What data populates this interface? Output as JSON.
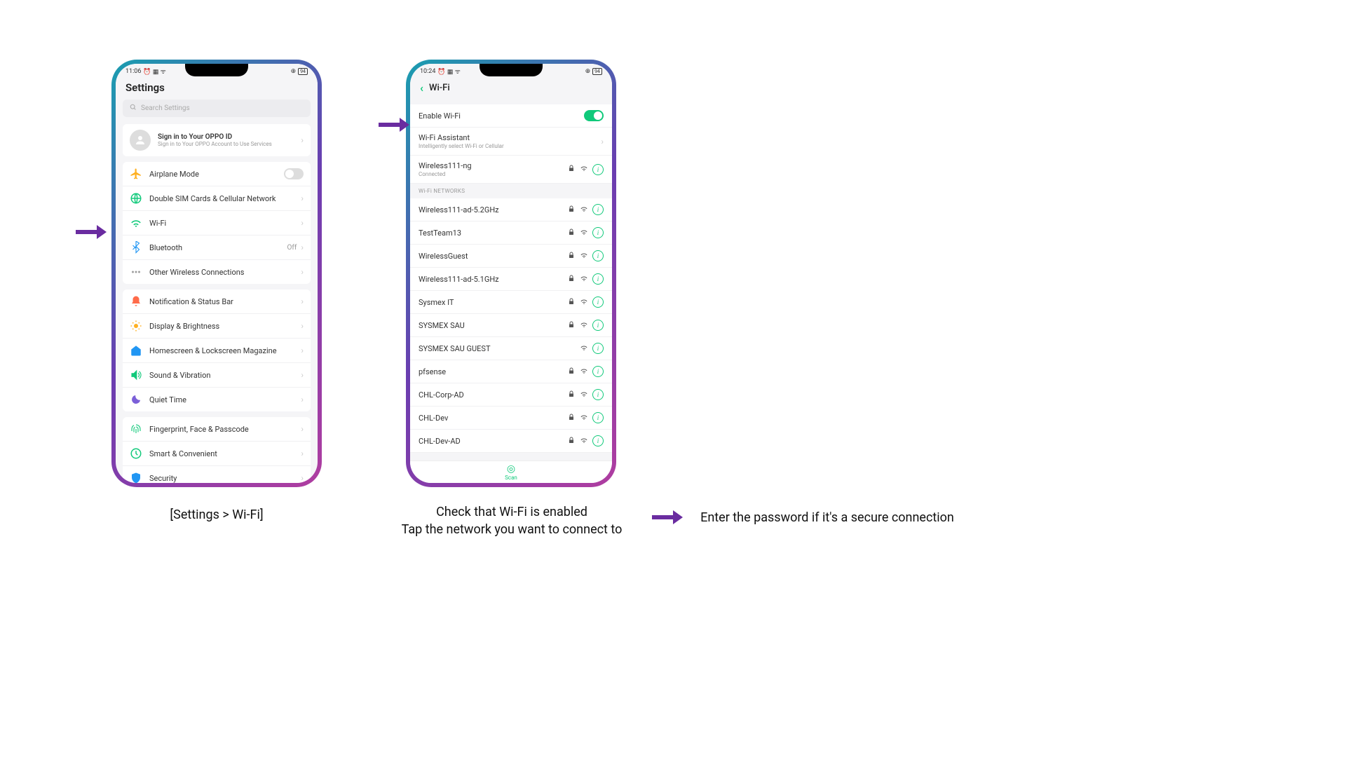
{
  "phone1": {
    "status_time": "11:06",
    "status_battery": "94",
    "title": "Settings",
    "search_placeholder": "Search Settings",
    "signin_title": "Sign in to Your OPPO ID",
    "signin_sub": "Sign in to Your OPPO Account to Use Services",
    "groups": [
      [
        {
          "icon": "airplane",
          "color": "#ffb020",
          "label": "Airplane Mode",
          "trail": "toggle-off"
        },
        {
          "icon": "globe",
          "color": "#10c97a",
          "label": "Double SIM Cards & Cellular Network",
          "trail": "chevron"
        },
        {
          "icon": "wifi",
          "color": "#10c97a",
          "label": "Wi-Fi",
          "trail": "chevron"
        },
        {
          "icon": "bluetooth",
          "color": "#2196f3",
          "label": "Bluetooth",
          "trail_text": "Off",
          "trail": "chevron"
        },
        {
          "icon": "dots",
          "color": "#9e9e9e",
          "label": "Other Wireless Connections",
          "trail": "chevron"
        }
      ],
      [
        {
          "icon": "bell",
          "color": "#ff6b4a",
          "label": "Notification & Status Bar",
          "trail": "chevron"
        },
        {
          "icon": "sun",
          "color": "#ffb020",
          "label": "Display & Brightness",
          "trail": "chevron"
        },
        {
          "icon": "home",
          "color": "#2196f3",
          "label": "Homescreen & Lockscreen Magazine",
          "trail": "chevron"
        },
        {
          "icon": "sound",
          "color": "#10c97a",
          "label": "Sound & Vibration",
          "trail": "chevron"
        },
        {
          "icon": "moon",
          "color": "#7b5fd8",
          "label": "Quiet Time",
          "trail": "chevron"
        }
      ],
      [
        {
          "icon": "finger",
          "color": "#10c97a",
          "label": "Fingerprint, Face & Passcode",
          "trail": "chevron"
        },
        {
          "icon": "smart",
          "color": "#10c97a",
          "label": "Smart & Convenient",
          "trail": "chevron"
        },
        {
          "icon": "shield",
          "color": "#2196f3",
          "label": "Security",
          "trail": "chevron"
        }
      ]
    ]
  },
  "phone2": {
    "status_time": "10:24",
    "status_battery": "94",
    "title": "Wi-Fi",
    "enable_label": "Enable Wi-Fi",
    "assistant_title": "Wi-Fi Assistant",
    "assistant_sub": "Intelligently select Wi-Fi or Cellular",
    "connected_name": "Wireless111-ng",
    "connected_status": "Connected",
    "section_header": "Wi-Fi NETWORKS",
    "networks": [
      {
        "name": "Wireless111-ad-5.2GHz",
        "locked": true
      },
      {
        "name": "TestTeam13",
        "locked": true
      },
      {
        "name": "WirelessGuest",
        "locked": true
      },
      {
        "name": "Wireless111-ad-5.1GHz",
        "locked": true
      },
      {
        "name": "Sysmex IT",
        "locked": true
      },
      {
        "name": "SYSMEX SAU",
        "locked": true
      },
      {
        "name": "SYSMEX SAU GUEST",
        "locked": false
      },
      {
        "name": "pfsense",
        "locked": true
      },
      {
        "name": "CHL-Corp-AD",
        "locked": true
      },
      {
        "name": "CHL-Dev",
        "locked": true
      },
      {
        "name": "CHL-Dev-AD",
        "locked": true
      }
    ],
    "scan_label": "Scan"
  },
  "captions": {
    "c1": "[Settings > Wi-Fi]",
    "c2a": "Check that Wi-Fi is enabled",
    "c2b": "Tap the network you want to connect to",
    "c3": "Enter the password if it's a secure connection"
  }
}
